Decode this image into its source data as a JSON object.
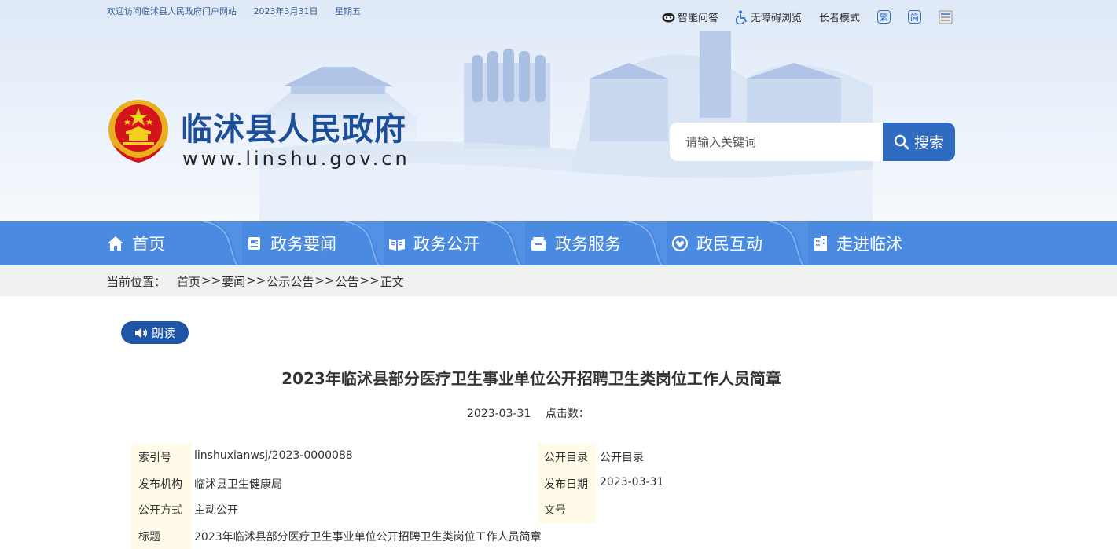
{
  "topbar": {
    "welcome": "欢迎访问临沭县人民政府门户网站",
    "date": "2023年3月31日",
    "weekday": "星期五",
    "tools": {
      "qa": "智能问答",
      "accessible": "无障碍浏览",
      "elder": "长者模式",
      "traditional": "繁",
      "simplified": "简"
    }
  },
  "site": {
    "title": "临沭县人民政府",
    "url": "www.linshu.gov.cn"
  },
  "search": {
    "placeholder": "请输入关键词",
    "button": "搜索"
  },
  "nav": {
    "items": [
      {
        "label": "首页",
        "icon": "home-icon"
      },
      {
        "label": "政务要闻",
        "icon": "news-icon"
      },
      {
        "label": "政务公开",
        "icon": "book-icon"
      },
      {
        "label": "政务服务",
        "icon": "service-icon"
      },
      {
        "label": "政民互动",
        "icon": "interaction-icon"
      },
      {
        "label": "走进临沭",
        "icon": "building-icon"
      }
    ]
  },
  "breadcrumb": {
    "lead": "当前位置：",
    "items": [
      "首页",
      "要闻",
      "公示公告",
      "公告",
      "正文"
    ],
    "sep": ">>"
  },
  "article": {
    "read_button": "朗读",
    "title": "2023年临沭县部分医疗卫生事业单位公开招聘卫生类岗位工作人员简章",
    "date": "2023-03-31",
    "clicks_label": "点击数："
  },
  "meta": {
    "index_label": "索引号",
    "index_value": "linshuxianwsj/2023-0000088",
    "catalog_label": "公开目录",
    "catalog_value": "公开目录",
    "org_label": "发布机构",
    "org_value": "临沭县卫生健康局",
    "pubdate_label": "发布日期",
    "pubdate_value": "2023-03-31",
    "mode_label": "公开方式",
    "mode_value": "主动公开",
    "docno_label": "文号",
    "docno_value": "",
    "subject_label": "标题",
    "subject_value": "2023年临沭县部分医疗卫生事业单位公开招聘卫生类岗位工作人员简章"
  },
  "colors": {
    "nav": "#4a8ae0",
    "title_blue": "#1d4f99",
    "search_btn": "#2e6bc1",
    "read_btn": "#1f56a6",
    "meta_key_bg": "#fffbe8"
  }
}
